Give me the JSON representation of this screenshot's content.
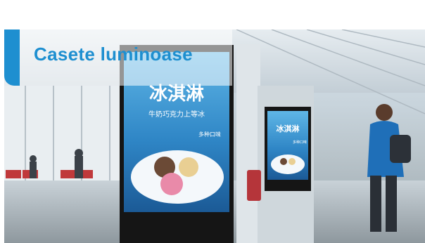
{
  "header": {
    "title": "Casete luminoase",
    "accent_color": "#1e8fd0"
  },
  "photo": {
    "poster_main": {
      "headline": "冰淇淋",
      "subheadline": "牛奶巧克力上等冰",
      "badge": "多种口味"
    },
    "poster_small": {
      "headline": "冰淇淋",
      "badge": "多种口味"
    }
  }
}
